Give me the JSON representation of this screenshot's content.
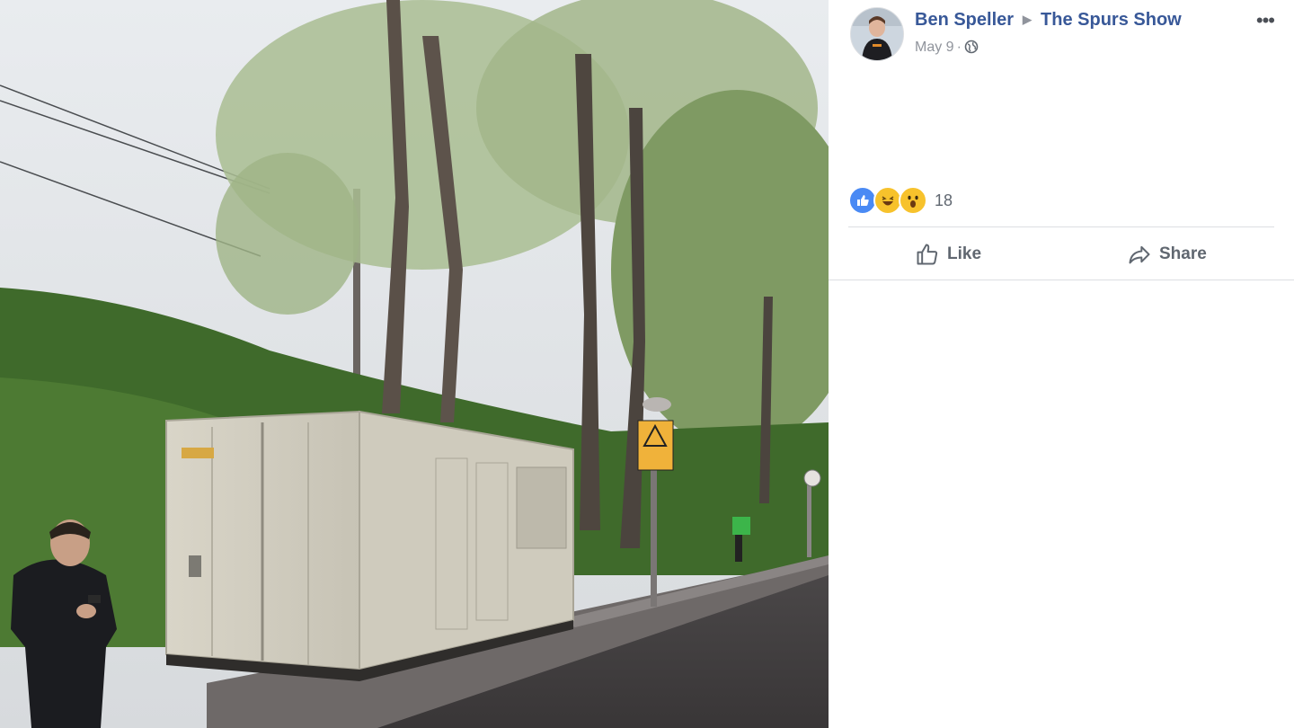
{
  "post": {
    "author": "Ben Speller",
    "target_page": "The Spurs Show",
    "date": "May 9",
    "separator": "·",
    "audience_icon": "globe-icon",
    "more_label": "•••"
  },
  "reactions": {
    "icons": [
      "like-reaction-icon",
      "haha-reaction-icon",
      "wow-reaction-icon"
    ],
    "count": "18"
  },
  "actions": {
    "like_label": "Like",
    "share_label": "Share"
  },
  "colors": {
    "link": "#385898",
    "secondary_text": "#90949c",
    "like_blue": "#4a8af4",
    "emoji_yellow": "#f7c22c"
  }
}
